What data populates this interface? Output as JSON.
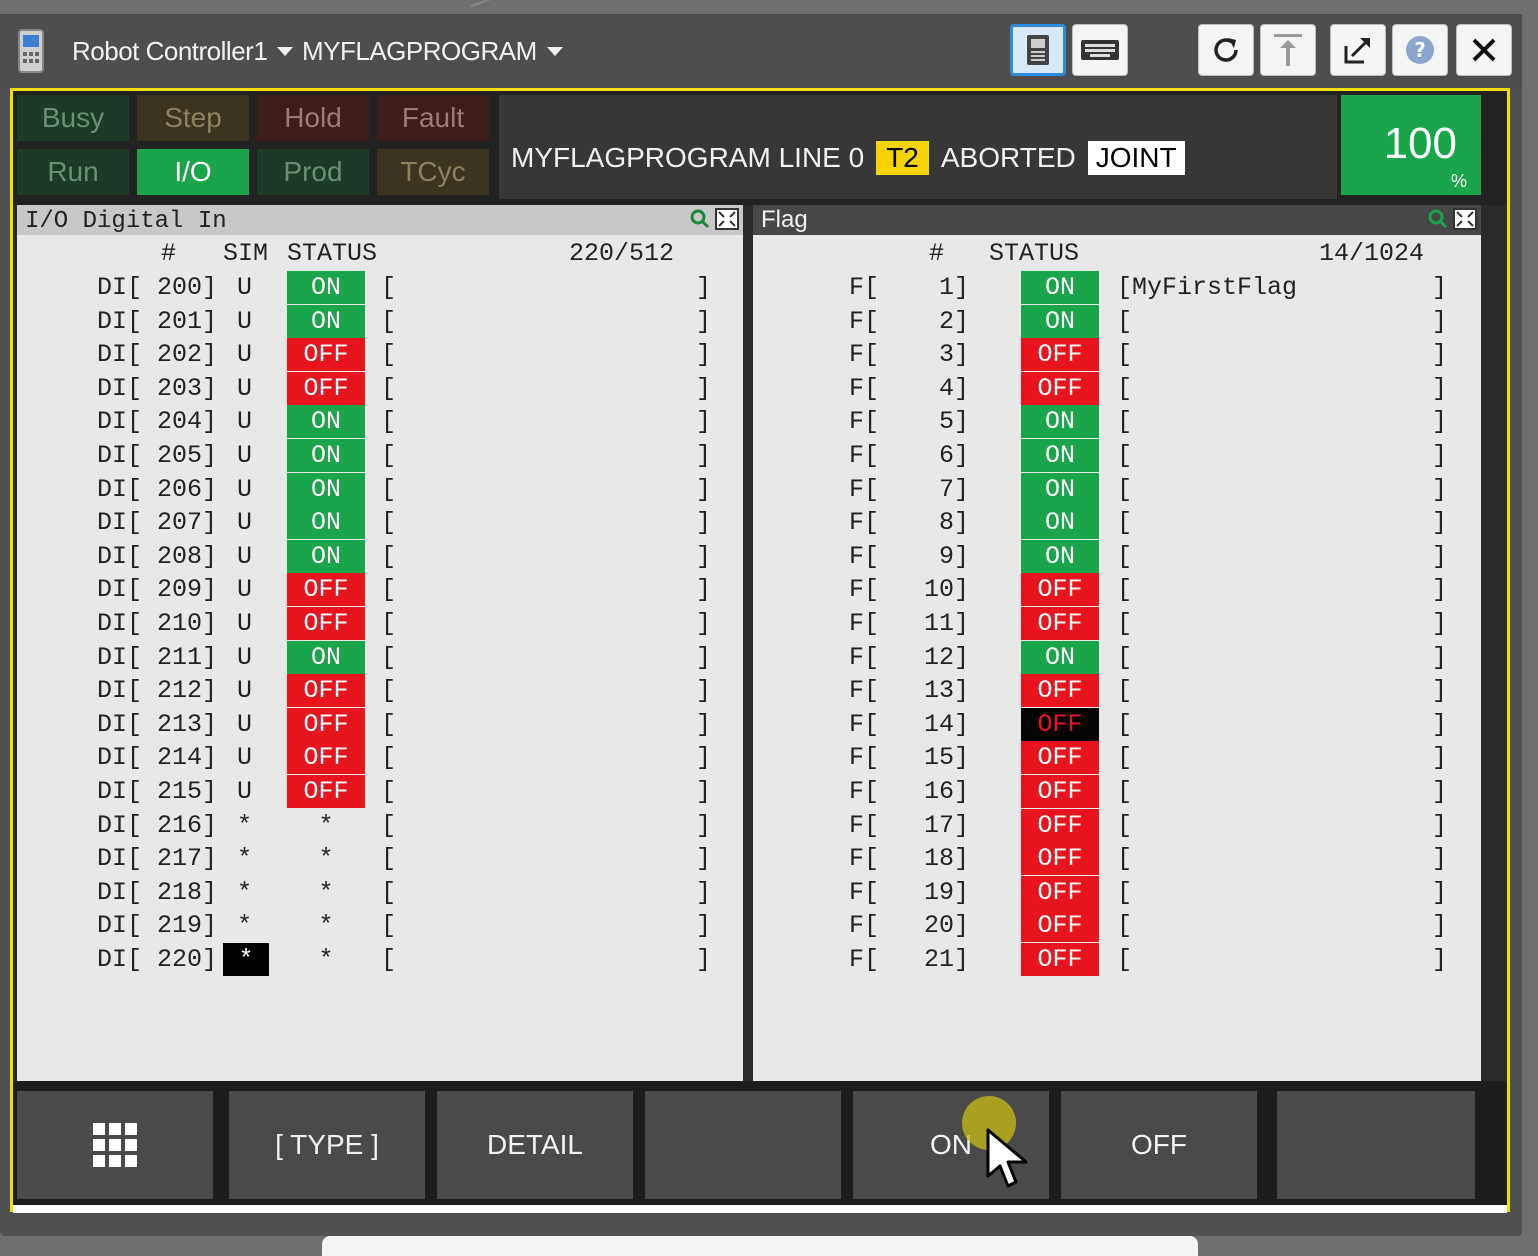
{
  "topbar": {
    "controller": "Robot Controller1",
    "program": "MYFLAGPROGRAM"
  },
  "status_leds": {
    "row1": [
      "Busy",
      "Step",
      "Hold",
      "Fault"
    ],
    "row2": [
      "Run",
      "I/O",
      "Prod",
      "TCyc"
    ]
  },
  "program_line": {
    "text": "MYFLAGPROGRAM LINE 0",
    "mode": "T2",
    "state": "ABORTED",
    "coord": "JOINT"
  },
  "speed": {
    "value": "100",
    "unit": "%"
  },
  "left_panel": {
    "title": "I/O Digital In",
    "hdr_num": "#",
    "hdr_sim": "SIM",
    "hdr_status": "STATUS",
    "count": "220/512",
    "rows": [
      {
        "label": "DI[ 200]",
        "sim": "U",
        "status": "ON",
        "comment": "[                    ]"
      },
      {
        "label": "DI[ 201]",
        "sim": "U",
        "status": "ON",
        "comment": "[                    ]"
      },
      {
        "label": "DI[ 202]",
        "sim": "U",
        "status": "OFF",
        "comment": "[                    ]"
      },
      {
        "label": "DI[ 203]",
        "sim": "U",
        "status": "OFF",
        "comment": "[                    ]"
      },
      {
        "label": "DI[ 204]",
        "sim": "U",
        "status": "ON",
        "comment": "[                    ]"
      },
      {
        "label": "DI[ 205]",
        "sim": "U",
        "status": "ON",
        "comment": "[                    ]"
      },
      {
        "label": "DI[ 206]",
        "sim": "U",
        "status": "ON",
        "comment": "[                    ]"
      },
      {
        "label": "DI[ 207]",
        "sim": "U",
        "status": "ON",
        "comment": "[                    ]"
      },
      {
        "label": "DI[ 208]",
        "sim": "U",
        "status": "ON",
        "comment": "[                    ]"
      },
      {
        "label": "DI[ 209]",
        "sim": "U",
        "status": "OFF",
        "comment": "[                    ]"
      },
      {
        "label": "DI[ 210]",
        "sim": "U",
        "status": "OFF",
        "comment": "[                    ]"
      },
      {
        "label": "DI[ 211]",
        "sim": "U",
        "status": "ON",
        "comment": "[                    ]"
      },
      {
        "label": "DI[ 212]",
        "sim": "U",
        "status": "OFF",
        "comment": "[                    ]"
      },
      {
        "label": "DI[ 213]",
        "sim": "U",
        "status": "OFF",
        "comment": "[                    ]"
      },
      {
        "label": "DI[ 214]",
        "sim": "U",
        "status": "OFF",
        "comment": "[                    ]"
      },
      {
        "label": "DI[ 215]",
        "sim": "U",
        "status": "OFF",
        "comment": "[                    ]"
      },
      {
        "label": "DI[ 216]",
        "sim": "*",
        "status": "*",
        "comment": "[                    ]"
      },
      {
        "label": "DI[ 217]",
        "sim": "*",
        "status": "*",
        "comment": "[                    ]"
      },
      {
        "label": "DI[ 218]",
        "sim": "*",
        "status": "*",
        "comment": "[                    ]"
      },
      {
        "label": "DI[ 219]",
        "sim": "*",
        "status": "*",
        "comment": "[                    ]"
      },
      {
        "label": "DI[ 220]",
        "sim": "*",
        "status": "*",
        "comment": "[                    ]",
        "selected": true
      }
    ]
  },
  "right_panel": {
    "title": "Flag",
    "hdr_num": "#",
    "hdr_status": "STATUS",
    "count": "14/1024",
    "rows": [
      {
        "label": "F[    1]",
        "status": "ON",
        "comment": "[MyFirstFlag         ]"
      },
      {
        "label": "F[    2]",
        "status": "ON",
        "comment": "[                    ]"
      },
      {
        "label": "F[    3]",
        "status": "OFF",
        "comment": "[                    ]"
      },
      {
        "label": "F[    4]",
        "status": "OFF",
        "comment": "[                    ]"
      },
      {
        "label": "F[    5]",
        "status": "ON",
        "comment": "[                    ]"
      },
      {
        "label": "F[    6]",
        "status": "ON",
        "comment": "[                    ]"
      },
      {
        "label": "F[    7]",
        "status": "ON",
        "comment": "[                    ]"
      },
      {
        "label": "F[    8]",
        "status": "ON",
        "comment": "[                    ]"
      },
      {
        "label": "F[    9]",
        "status": "ON",
        "comment": "[                    ]"
      },
      {
        "label": "F[   10]",
        "status": "OFF",
        "comment": "[                    ]"
      },
      {
        "label": "F[   11]",
        "status": "OFF",
        "comment": "[                    ]"
      },
      {
        "label": "F[   12]",
        "status": "ON",
        "comment": "[                    ]"
      },
      {
        "label": "F[   13]",
        "status": "OFF",
        "comment": "[                    ]"
      },
      {
        "label": "F[   14]",
        "status": "OFF",
        "comment": "[                    ]",
        "selected": true
      },
      {
        "label": "F[   15]",
        "status": "OFF",
        "comment": "[                    ]"
      },
      {
        "label": "F[   16]",
        "status": "OFF",
        "comment": "[                    ]"
      },
      {
        "label": "F[   17]",
        "status": "OFF",
        "comment": "[                    ]"
      },
      {
        "label": "F[   18]",
        "status": "OFF",
        "comment": "[                    ]"
      },
      {
        "label": "F[   19]",
        "status": "OFF",
        "comment": "[                    ]"
      },
      {
        "label": "F[   20]",
        "status": "OFF",
        "comment": "[                    ]"
      },
      {
        "label": "F[   21]",
        "status": "OFF",
        "comment": "[                    ]"
      }
    ]
  },
  "fkeys": [
    "",
    "[ TYPE ]",
    "DETAIL",
    "",
    "ON",
    "OFF",
    ""
  ],
  "colors": {
    "on": "#1aa54b",
    "off": "#e8141e",
    "frame": "#f0e000"
  },
  "icons": [
    "pendant-icon",
    "teach-pendant-icon",
    "keyboard-icon",
    "refresh-icon",
    "jog-icon",
    "popout-icon",
    "help-icon",
    "close-icon",
    "grid-menu-icon",
    "zoom-icon",
    "maximize-icon"
  ]
}
